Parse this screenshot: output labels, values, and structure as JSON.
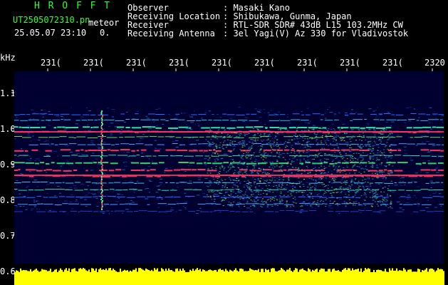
{
  "header": {
    "brand": "H R O F F T",
    "filename": "UT2505072310.pn",
    "type_label": "meteor",
    "datetime": "25.05.07 23:10",
    "count": "0.",
    "fields": [
      {
        "label": "Observer",
        "value": ": Masaki Kano"
      },
      {
        "label": "Receiving Location",
        "value": ": Shibukawa, Gunma, Japan"
      },
      {
        "label": "Receiver",
        "value": ": RTL-SDR SDR# 43dB L15 103.2MHz CW"
      },
      {
        "label": "Receiving Antenna",
        "value": ": 3el Yagi(V) Az 330 for Vladivostok"
      }
    ]
  },
  "axes": {
    "y_unit": "kHz",
    "x_ticks": [
      "231(",
      "231(",
      "231(",
      "231(",
      "231(",
      "231(",
      "231(",
      "231(",
      "231(",
      "2320"
    ],
    "y_ticks": [
      "1.1",
      "1.0",
      "0.9",
      "0.8",
      "0.7",
      "0.6"
    ]
  },
  "colors": {
    "background": "#000000",
    "plot_bg": "#000030",
    "brand": "#33ff33",
    "text": "#ffffff",
    "level_bar": "#ffff00"
  }
}
